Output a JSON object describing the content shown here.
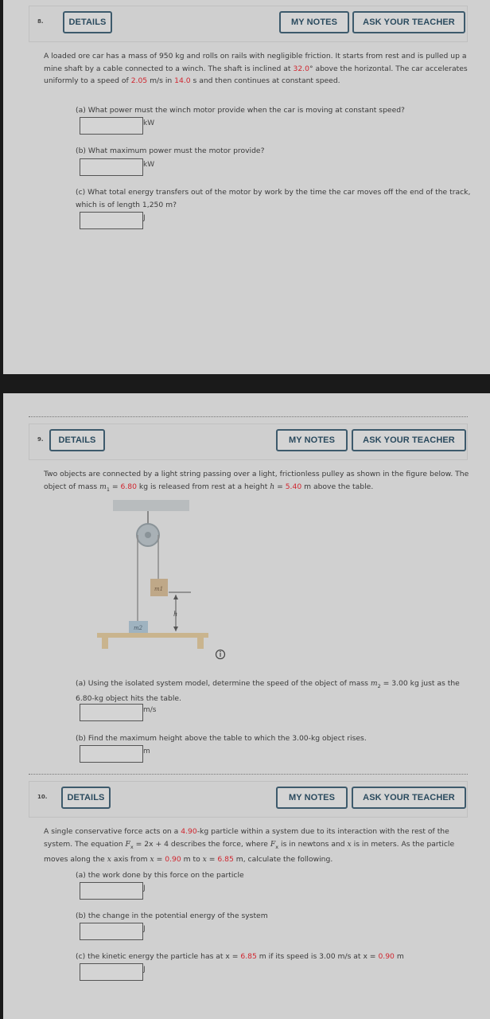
{
  "buttons": {
    "details": "DETAILS",
    "my_notes": "MY NOTES",
    "ask_teacher": "ASK YOUR TEACHER"
  },
  "questions": [
    {
      "number": "8.",
      "prompt": {
        "p1": "A loaded ore car has a mass of 950 kg and rolls on rails with negligible friction. It starts from rest and is pulled up a mine shaft by a cable connected to a winch. The shaft is inclined at ",
        "v1": "32.0",
        "p2": "° above the horizontal. The car accelerates uniformly to a speed of ",
        "v2": "2.05",
        "p3": " m/s in ",
        "v3": "14.0",
        "p4": " s and then continues at constant speed."
      },
      "parts": [
        {
          "text": "(a) What power must the winch motor provide when the car is moving at constant speed?",
          "unit": "kW",
          "value": ""
        },
        {
          "text": "(b) What maximum power must the motor provide?",
          "unit": "kW",
          "value": ""
        },
        {
          "text": "(c) What total energy transfers out of the motor by work by the time the car moves off the end of the track, which is of length 1,250 m?",
          "unit": "J",
          "value": ""
        }
      ]
    },
    {
      "number": "9.",
      "prompt": {
        "p1": "Two objects are connected by a light string passing over a light, frictionless pulley as shown in the figure below. The object of mass ",
        "m1": "m",
        "m1sub": "1",
        "p2": " = ",
        "v1": "6.80",
        "p3": " kg is released from rest at a height ",
        "h": "h",
        "p4": " = ",
        "v2": "5.40",
        "p5": " m above the table."
      },
      "figure": {
        "m1_label": "m1",
        "m2_label": "m2",
        "h_label": "h",
        "info_icon": "info-icon"
      },
      "parts": [
        {
          "text_a": "(a) Using the isolated system model, determine the speed of the object of mass ",
          "m2": "m",
          "m2sub": "2",
          "text_b": " = 3.00 kg just as the 6.80-kg object hits the table.",
          "unit": "m/s",
          "value": ""
        },
        {
          "text": "(b) Find the maximum height above the table to which the 3.00-kg object rises.",
          "unit": "m",
          "value": ""
        }
      ]
    },
    {
      "number": "10.",
      "prompt": {
        "p1": "A single conservative force acts on a ",
        "v1": "4.90",
        "p2": "-kg particle within a system due to its interaction with the rest of the system. The equation ",
        "F": "F",
        "Fsub": "x",
        "p3": " = 2x + 4 describes the force, where ",
        "p4": " is in newtons and ",
        "x": "x",
        "p5": " is in meters. As the particle moves along the ",
        "p6": " axis from ",
        "p7": " = ",
        "v2": "0.90",
        "p8": " m to ",
        "v3": "6.85",
        "p9": " m, calculate the following."
      },
      "parts": [
        {
          "text": "(a) the work done by this force on the particle",
          "unit": "J",
          "value": ""
        },
        {
          "text": "(b) the change in the potential energy of the system",
          "unit": "J",
          "value": ""
        },
        {
          "text_a": "(c) the kinetic energy the particle has at x = ",
          "v1": "6.85",
          "text_b": " m if its speed is 3.00 m/s at x = ",
          "v2": "0.90",
          "text_c": " m",
          "unit": "J",
          "value": ""
        }
      ]
    }
  ]
}
